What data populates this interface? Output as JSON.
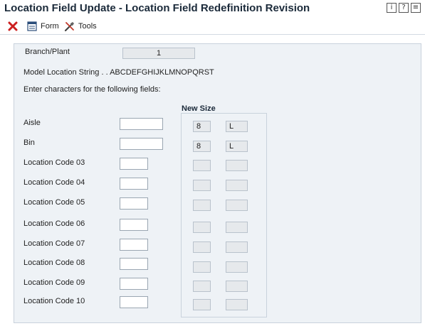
{
  "window": {
    "title": "Location Field Update - Location Field Redefinition Revision",
    "icons": [
      {
        "name": "info-icon",
        "glyph": "i"
      },
      {
        "name": "help-icon",
        "glyph": "?"
      },
      {
        "name": "menu-icon",
        "glyph": "≡"
      }
    ]
  },
  "toolbar": {
    "close_icon": "close-icon",
    "form_label": "Form",
    "tools_label": "Tools"
  },
  "form": {
    "branch_plant_label": "Branch/Plant",
    "branch_plant_value": "1",
    "model_location_string": "Model Location String . . ABCDEFGHIJKLMNOPQRST",
    "instruction": "Enter characters for the following fields:",
    "new_size_heading": "New Size",
    "fields": [
      {
        "label": "Aisle",
        "value": "",
        "size": "8",
        "justify": "L"
      },
      {
        "label": "Bin",
        "value": "",
        "size": "8",
        "justify": "L"
      },
      {
        "label": "Location Code 03",
        "value": "",
        "size": "",
        "justify": ""
      },
      {
        "label": "Location Code 04",
        "value": "",
        "size": "",
        "justify": ""
      },
      {
        "label": "Location Code 05",
        "value": "",
        "size": "",
        "justify": ""
      },
      {
        "label": "Location Code 06",
        "value": "",
        "size": "",
        "justify": ""
      },
      {
        "label": "Location Code 07",
        "value": "",
        "size": "",
        "justify": ""
      },
      {
        "label": "Location Code 08",
        "value": "",
        "size": "",
        "justify": ""
      },
      {
        "label": "Location Code 09",
        "value": "",
        "size": "",
        "justify": ""
      },
      {
        "label": "Location Code 10",
        "value": "",
        "size": "",
        "justify": ""
      }
    ]
  },
  "colors": {
    "title_text": "#1b2a3a",
    "panel_bg": "#eef2f6",
    "close_red": "#cc1f1f"
  }
}
